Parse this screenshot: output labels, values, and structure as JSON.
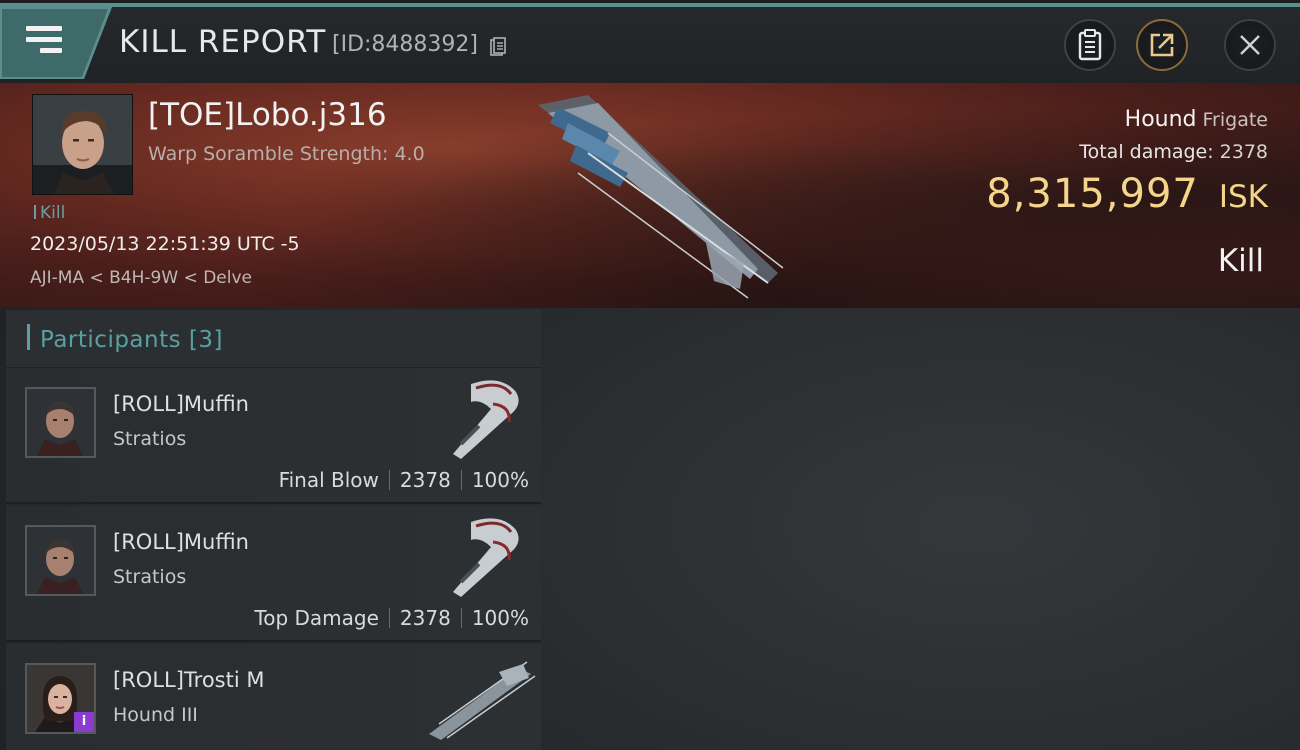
{
  "header": {
    "title": "KILL REPORT",
    "report_id": "[ID:8488392]",
    "icons": [
      "menu-icon",
      "copy-icon",
      "clipboard-icon",
      "share-icon",
      "close-icon"
    ]
  },
  "victim": {
    "name": "[TOE]Lobo.j316",
    "scramble": "Warp Soramble Strength: 4.0",
    "kill_tag": "Kill",
    "datetime": "2023/05/13 22:51:39 UTC -5",
    "location": "AJI-MA < B4H-9W < Delve",
    "ship_name": "Hound",
    "ship_class": "Frigate",
    "total_damage_label": "Total damage:",
    "total_damage": "2378",
    "isk_value": "8,315,997",
    "isk_unit": "ISK",
    "outcome": "Kill"
  },
  "participants": {
    "title": "Participants [3]",
    "rows": [
      {
        "name": "[ROLL]Muffin",
        "ship": "Stratios",
        "role": "Final Blow",
        "damage": "2378",
        "percent": "100%"
      },
      {
        "name": "[ROLL]Muffin",
        "ship": "Stratios",
        "role": "Top Damage",
        "damage": "2378",
        "percent": "100%"
      },
      {
        "name": "[ROLL]Trosti M",
        "ship": "Hound III",
        "badge": "i"
      }
    ]
  },
  "colors": {
    "accent": "#5aa0a2",
    "isk": "#f5d58a",
    "banner": "#6b2c22",
    "badge": "#8a3bd1"
  }
}
